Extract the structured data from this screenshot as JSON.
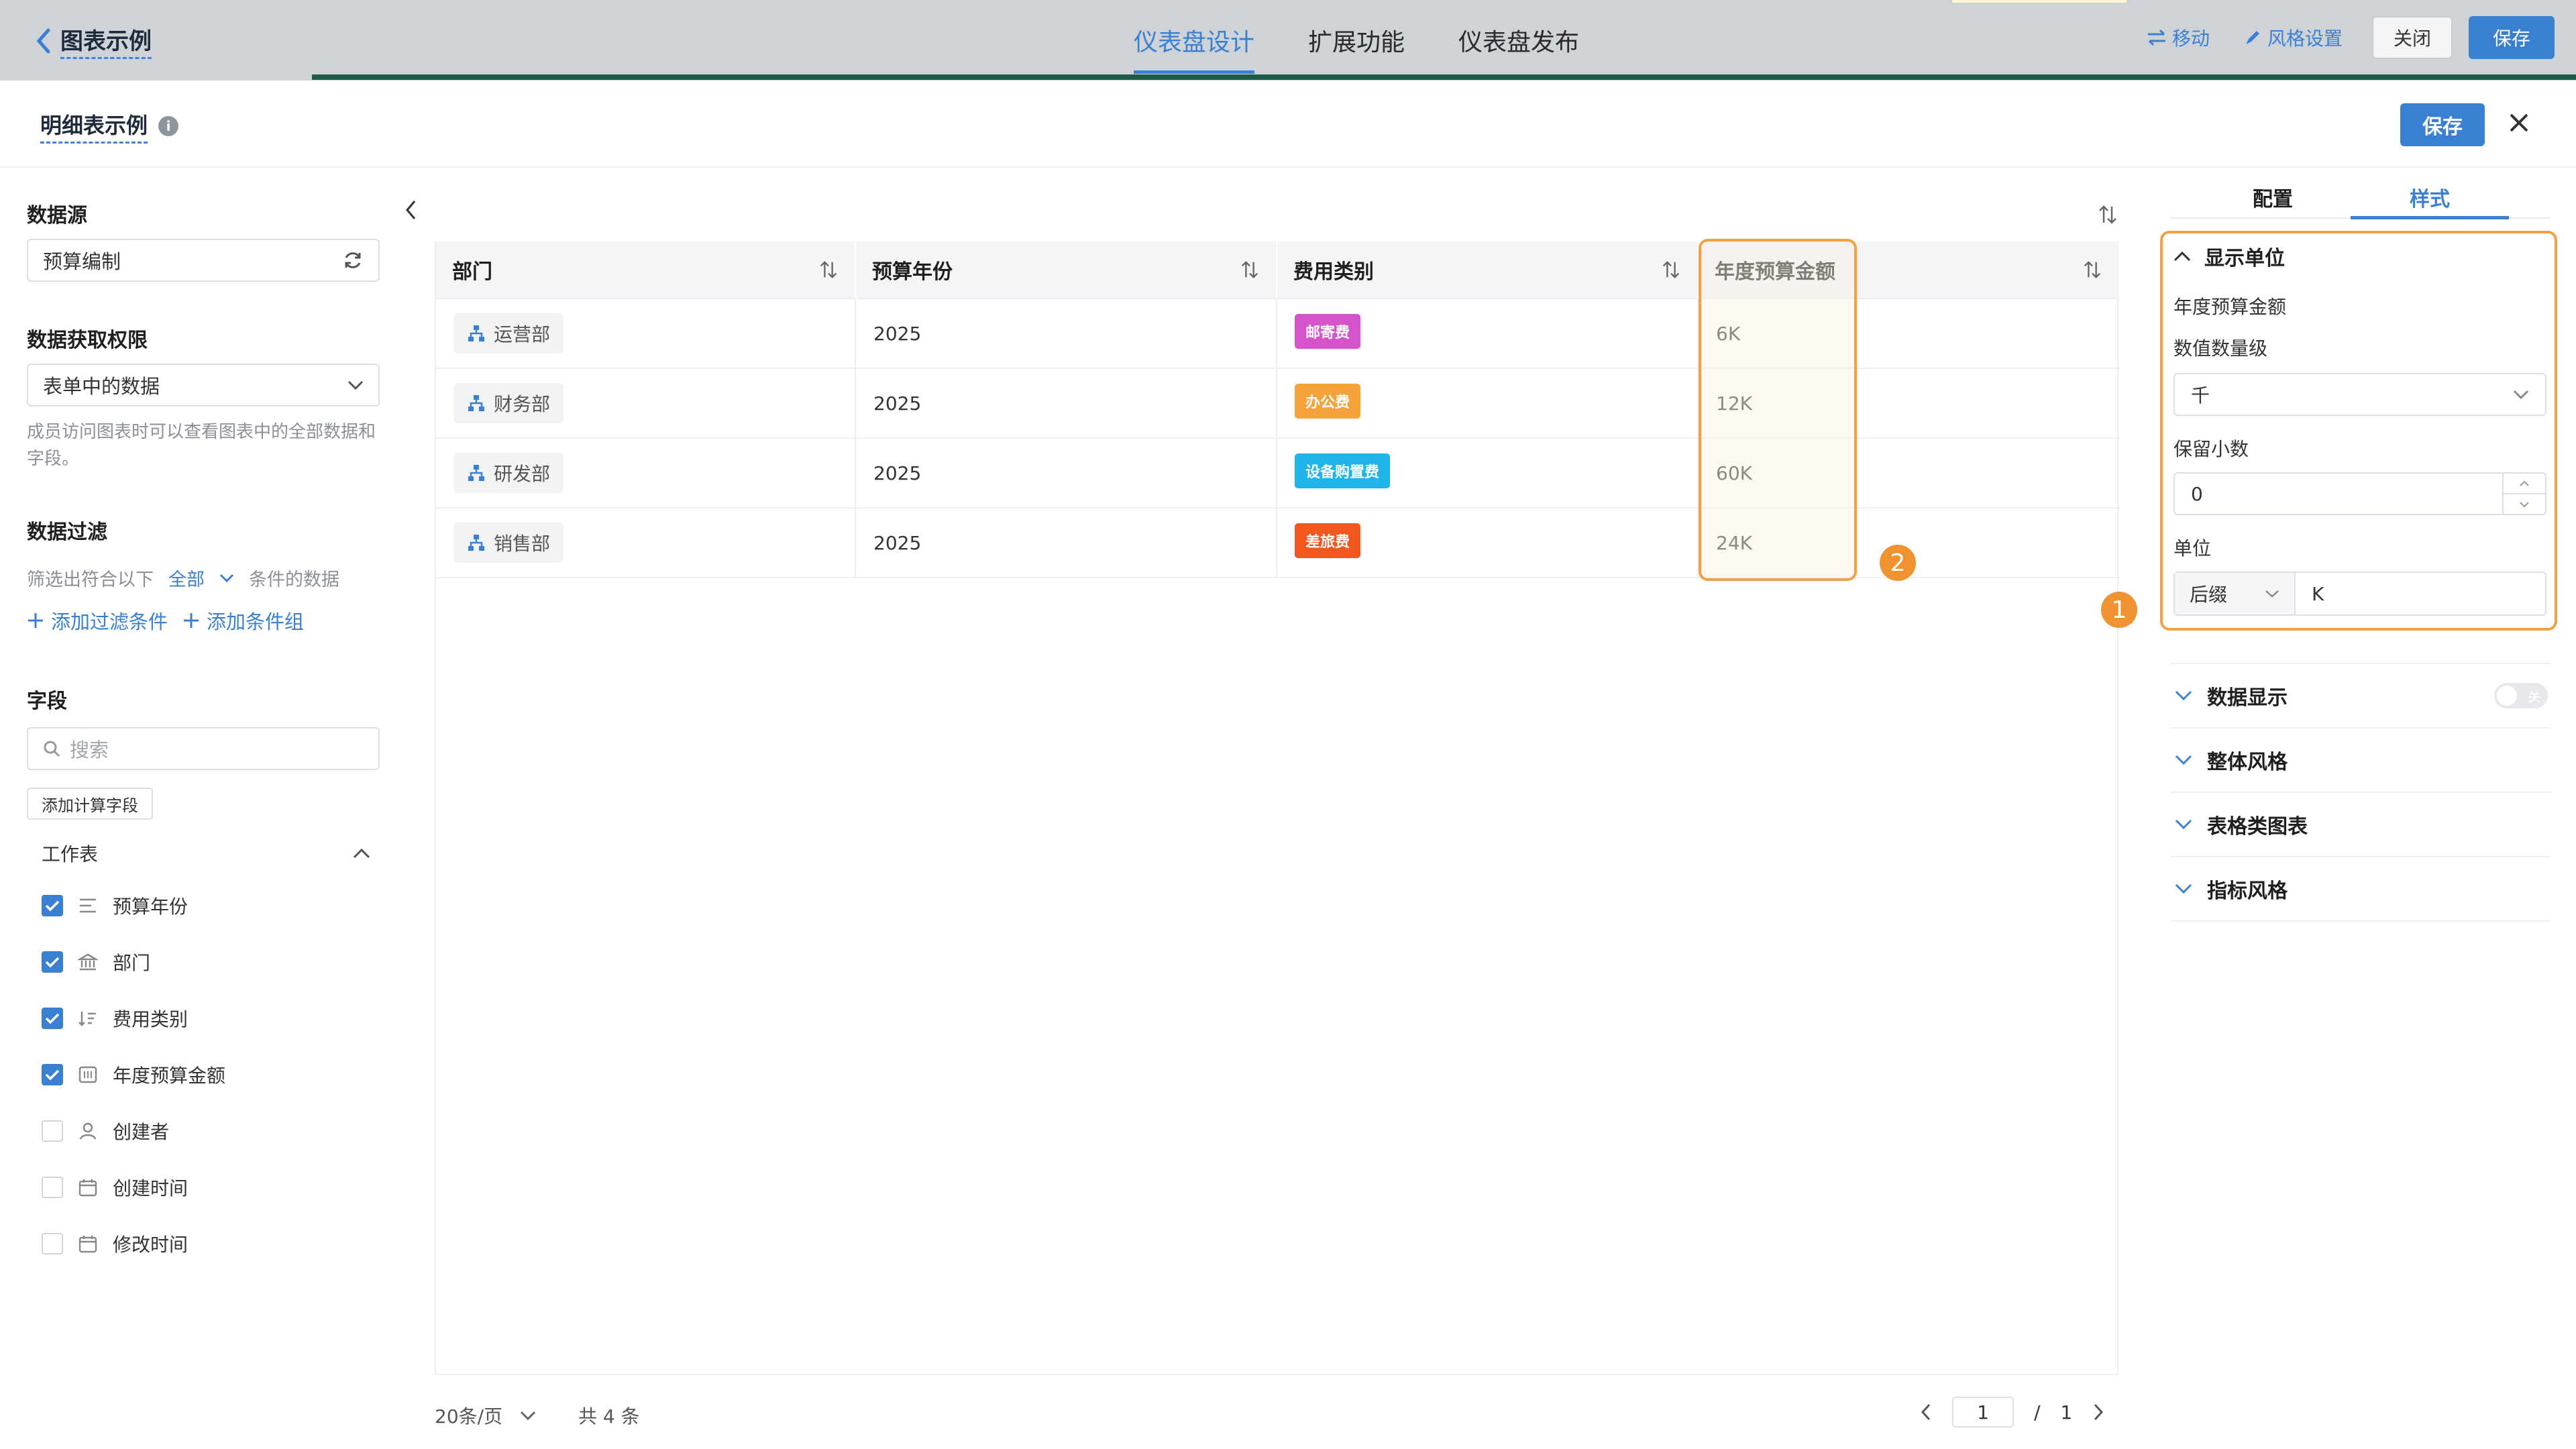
{
  "topbar": {
    "back_label": "图表示例",
    "tabs": [
      "仪表盘设计",
      "扩展功能",
      "仪表盘发布"
    ],
    "move_label": "移动",
    "style_label": "风格设置",
    "close_label": "关闭",
    "save_label": "保存"
  },
  "modal": {
    "title": "明细表示例",
    "info_icon": "i",
    "save_label": "保存"
  },
  "left": {
    "datasource_title": "数据源",
    "datasource_value": "预算编制",
    "permission_title": "数据获取权限",
    "permission_value": "表单中的数据",
    "permission_hint": "成员访问图表时可以查看图表中的全部数据和字段。",
    "filter_title": "数据过滤",
    "filter_prefix": "筛选出符合以下",
    "filter_mode": "全部",
    "filter_suffix": "条件的数据",
    "add_filter": "添加过滤条件",
    "add_group": "添加条件组",
    "fields_title": "字段",
    "search_placeholder": "搜索",
    "add_calc": "添加计算字段",
    "worksheet": "工作表",
    "fields": [
      {
        "label": "预算年份",
        "checked": true,
        "icon": "text-lines-icon"
      },
      {
        "label": "部门",
        "checked": true,
        "icon": "department-icon"
      },
      {
        "label": "费用类别",
        "checked": true,
        "icon": "list-sort-icon"
      },
      {
        "label": "年度预算金额",
        "checked": true,
        "icon": "number-icon"
      },
      {
        "label": "创建者",
        "checked": false,
        "icon": "person-icon"
      },
      {
        "label": "创建时间",
        "checked": false,
        "icon": "calendar-icon"
      },
      {
        "label": "修改时间",
        "checked": false,
        "icon": "calendar-icon"
      }
    ]
  },
  "table": {
    "columns": [
      "部门",
      "预算年份",
      "费用类别",
      "年度预算金额",
      ""
    ],
    "rows": [
      {
        "dept": "运营部",
        "year": "2025",
        "category": "邮寄费",
        "cat_color": "#d654c9",
        "amount": "6K"
      },
      {
        "dept": "财务部",
        "year": "2025",
        "category": "办公费",
        "cat_color": "#f6a23a",
        "amount": "12K"
      },
      {
        "dept": "研发部",
        "year": "2025",
        "category": "设备购置费",
        "cat_color": "#1fb5e8",
        "amount": "60K"
      },
      {
        "dept": "销售部",
        "year": "2025",
        "category": "差旅费",
        "cat_color": "#f3561f",
        "amount": "24K"
      }
    ],
    "page_size": "20条/页",
    "total": "共 4 条",
    "current_page": "1",
    "page_sep": "/",
    "page_count": "1"
  },
  "right": {
    "tabs": [
      "配置",
      "样式"
    ],
    "active_tab": "样式",
    "unit_section": "显示单位",
    "field_name": "年度预算金额",
    "magnitude_label": "数值数量级",
    "magnitude_value": "千",
    "decimals_label": "保留小数",
    "decimals_value": "0",
    "unit_label": "单位",
    "unit_position": "后缀",
    "unit_value": "K",
    "data_display": "数据显示",
    "toggle_text": "关",
    "overall_style": "整体风格",
    "table_chart": "表格类图表",
    "metric_style": "指标风格"
  },
  "annotations": {
    "badge1": "1",
    "badge2": "2"
  },
  "colors": {
    "accent": "#3a80d2",
    "highlight": "#f3a044"
  }
}
